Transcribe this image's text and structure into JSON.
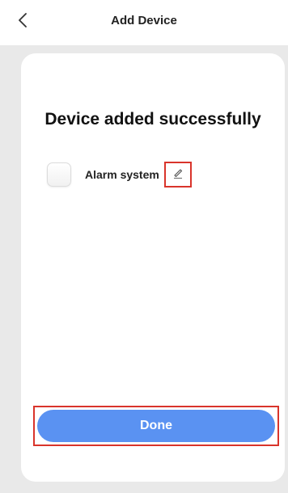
{
  "header": {
    "title": "Add Device",
    "back_icon": "chevron-left-icon"
  },
  "card": {
    "title": "Device added successfully",
    "device": {
      "name": "Alarm system",
      "edit_icon": "pencil-icon"
    },
    "done_label": "Done"
  },
  "colors": {
    "accent": "#5a92f2",
    "highlight": "#d9342b",
    "background": "#e9e9e9"
  }
}
